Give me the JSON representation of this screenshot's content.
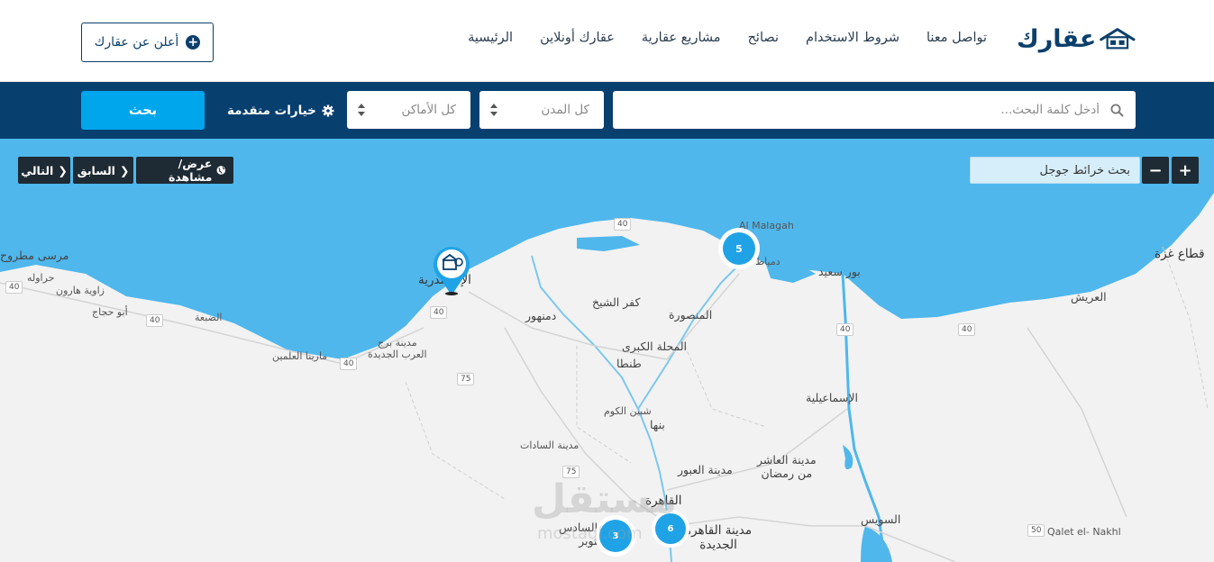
{
  "header": {
    "logo_text": "عقارك",
    "nav": [
      "الرئيسية",
      "عقارك أونلاين",
      "مشاريع عقارية",
      "نصائح",
      "شروط الاستخدام",
      "تواصل معنا"
    ],
    "advertise_label": "أعلن عن عقارك"
  },
  "search": {
    "keyword_placeholder": "أدخل كلمة البحث...",
    "city_value": "كل المدن",
    "place_value": "كل الأماكن",
    "advanced_label": "خيارات متقدمة",
    "search_button": "بحث"
  },
  "map": {
    "google_search_placeholder": "بحث خرائط جوجل",
    "zoom_in": "+",
    "zoom_out": "−",
    "view_label": "عرض/مشاهدة",
    "prev_label": "السابق",
    "next_label": "التالي",
    "clusters": [
      {
        "count": "5"
      },
      {
        "count": "6"
      },
      {
        "count": "3"
      }
    ],
    "labels": {
      "marsa": "مرسى مطروح",
      "haraweh": "حراوله",
      "zawyat": "زاوية هارون",
      "abu_hagag": "أبو حجاج",
      "dabaa": "الضبعة",
      "marina": "مارينا العلمين",
      "borg": "مدينة برج\nالعرب الجديدة",
      "alex": "الإسكندرية",
      "damanhour": "دمنهور",
      "kafr": "كفر الشيخ",
      "mansoura": "المنصورة",
      "mahalla": "المحلة الكبرى",
      "tanta": "طنطا",
      "shebin": "شبين الكوم",
      "banha": "بنها",
      "sadat": "مدينة السادات",
      "obour": "مدينة العبور",
      "tenth": "مدينة العاشر\nمن رمضان",
      "cairo": "القاهرة",
      "october": "مدينة السادس\nأكتوبر",
      "new_cairo": "مدينة القاهرة\nالجديدة",
      "malagah": "Al Malagah",
      "damietta": "دمياط",
      "port_said": "بور سعيد",
      "ismailia": "الإسماعيلية",
      "suez": "السويس",
      "arish": "العريش",
      "gaza": "قطاع غزة",
      "qalet": "Qalet el- Nakhl"
    },
    "road_numbers": [
      "40",
      "40",
      "40",
      "40",
      "40",
      "40",
      "75",
      "75",
      "40",
      "50"
    ]
  },
  "watermark": {
    "text": "مستقل",
    "sub": "mostaql.com"
  },
  "colors": {
    "brand_dark": "#073f6f",
    "accent": "#00a6ec",
    "sea": "#4fb7ec",
    "land": "#f2f2f2"
  }
}
